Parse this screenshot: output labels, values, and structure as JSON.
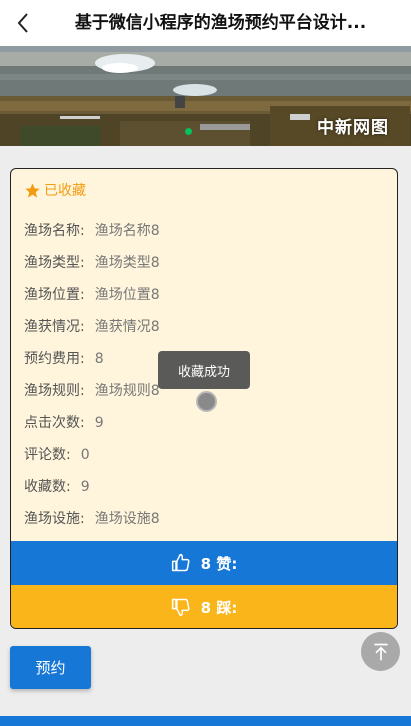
{
  "nav": {
    "title": "基于微信小程序的渔场预约平台设计...",
    "back_icon": "chevron-left-icon"
  },
  "banner": {
    "watermark": "中新网图",
    "active_indicator_color": "#07c160"
  },
  "card": {
    "favorite_label": "已收藏",
    "favorite_icon": "star-icon",
    "fields": [
      {
        "label": "渔场名称:",
        "value": "渔场名称8"
      },
      {
        "label": "渔场类型:",
        "value": "渔场类型8"
      },
      {
        "label": "渔场位置:",
        "value": "渔场位置8"
      },
      {
        "label": "渔获情况:",
        "value": "渔获情况8"
      },
      {
        "label": "预约费用:",
        "value": "8"
      },
      {
        "label": "渔场规则:",
        "value": "渔场规则8"
      },
      {
        "label": "点击次数:",
        "value": "9"
      },
      {
        "label": "评论数:",
        "value": "0"
      },
      {
        "label": "收藏数:",
        "value": "9"
      },
      {
        "label": "渔场设施:",
        "value": "渔场设施8"
      }
    ],
    "like_label": "8 赞:",
    "dislike_label": "8 踩:"
  },
  "toast": {
    "message": "收藏成功"
  },
  "actions": {
    "book_label": "预约",
    "scroll_top_icon": "arrow-up-icon"
  },
  "colors": {
    "primary": "#1677d6",
    "accent": "#f9b51a",
    "favorite": "#f39c12",
    "card_bg": "#fff5dc"
  }
}
